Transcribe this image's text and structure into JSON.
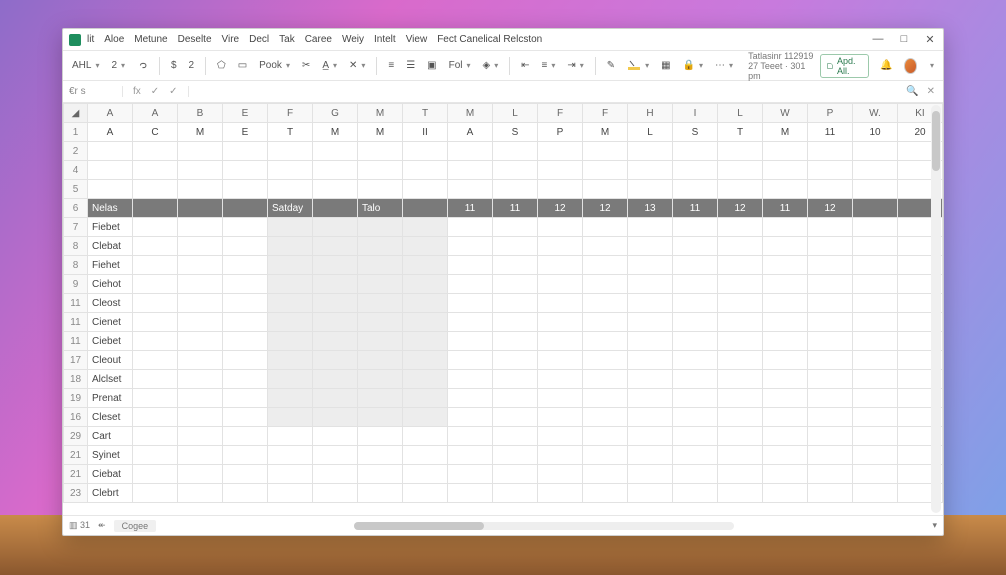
{
  "menu": [
    "lit",
    "Aloe",
    "Metune",
    "Deselte",
    "Vire",
    "Decl",
    "Tak",
    "Caree",
    "Weiy",
    "Intelt",
    "View",
    "Fect Canelical Relcston"
  ],
  "winctrls": {
    "min": "—",
    "max": "□",
    "close": "✕"
  },
  "toolbar": {
    "a": "AHL",
    "fmt": "Pook",
    "fol": "Fol",
    "info_line1": "Tatlasinr 112919",
    "info_line2": "27 Teeet · 301 pm",
    "pill": "Apd. All."
  },
  "formulabar": {
    "namebox": "€r s",
    "fx": "fx",
    "check": "✓",
    "check2": "✓",
    "search": "🔍",
    "close": "✕"
  },
  "col_headers_top": [
    "A",
    "A",
    "B",
    "E",
    "F",
    "G",
    "M",
    "T",
    "M",
    "L",
    "F",
    "F",
    "H",
    "I",
    "L",
    "W",
    "P",
    "W.",
    "KI"
  ],
  "col_headers_row1": [
    "A",
    "C",
    "M",
    "E",
    "T",
    "M",
    "M",
    "II",
    "A",
    "S",
    "P",
    "M",
    "L",
    "S",
    "T",
    "M",
    "11",
    "10",
    "20"
  ],
  "rows": [
    {
      "n": "2",
      "cells": [
        "",
        "",
        "",
        "",
        "",
        "",
        "",
        "",
        "",
        "",
        "",
        "",
        "",
        "",
        "",
        "",
        "",
        "",
        ""
      ]
    },
    {
      "n": "4",
      "cells": [
        "",
        "",
        "",
        "",
        "",
        "",
        "",
        "",
        "",
        "",
        "",
        "",
        "",
        "",
        "",
        "",
        "",
        "",
        ""
      ]
    },
    {
      "n": "5",
      "cells": [
        "",
        "",
        "",
        "",
        "",
        "",
        "",
        "",
        "",
        "",
        "",
        "",
        "",
        "",
        "",
        "",
        "",
        "",
        ""
      ]
    },
    {
      "n": "6",
      "dark": true,
      "cells": [
        "Nelas",
        "",
        "",
        "",
        "Satday",
        "",
        "Talo",
        "",
        "11",
        "11",
        "12",
        "12",
        "13",
        "11",
        "12",
        "11",
        "12",
        "",
        ""
      ]
    },
    {
      "n": "7",
      "sel": true,
      "cells": [
        "Fiebet",
        "",
        "",
        "",
        "",
        "",
        "",
        "",
        "",
        "",
        "",
        "",
        "",
        "",
        "",
        "",
        "",
        "",
        ""
      ]
    },
    {
      "n": "8",
      "sel": true,
      "cells": [
        "Clebat",
        "",
        "",
        "",
        "",
        "",
        "",
        "",
        "",
        "",
        "",
        "",
        "",
        "",
        "",
        "",
        "",
        "",
        ""
      ]
    },
    {
      "n": "8",
      "sel": true,
      "cells": [
        "Fiehet",
        "",
        "",
        "",
        "",
        "",
        "",
        "",
        "",
        "",
        "",
        "",
        "",
        "",
        "",
        "",
        "",
        "",
        ""
      ]
    },
    {
      "n": "9",
      "sel": true,
      "cells": [
        "Ciehot",
        "",
        "",
        "",
        "",
        "",
        "",
        "",
        "",
        "",
        "",
        "",
        "",
        "",
        "",
        "",
        "",
        "",
        ""
      ]
    },
    {
      "n": "11",
      "sel": true,
      "cells": [
        "Cleost",
        "",
        "",
        "",
        "",
        "",
        "",
        "",
        "",
        "",
        "",
        "",
        "",
        "",
        "",
        "",
        "",
        "",
        ""
      ]
    },
    {
      "n": "11",
      "sel": true,
      "cells": [
        "Cienet",
        "",
        "",
        "",
        "",
        "",
        "",
        "",
        "",
        "",
        "",
        "",
        "",
        "",
        "",
        "",
        "",
        "",
        ""
      ]
    },
    {
      "n": "11",
      "sel": true,
      "cells": [
        "Ciebet",
        "",
        "",
        "",
        "",
        "",
        "",
        "",
        "",
        "",
        "",
        "",
        "",
        "",
        "",
        "",
        "",
        "",
        ""
      ]
    },
    {
      "n": "17",
      "sel": true,
      "cells": [
        "Cleout",
        "",
        "",
        "",
        "",
        "",
        "",
        "",
        "",
        "",
        "",
        "",
        "",
        "",
        "",
        "",
        "",
        "",
        ""
      ]
    },
    {
      "n": "18",
      "sel": true,
      "cells": [
        "Alclset",
        "",
        "",
        "",
        "",
        "",
        "",
        "",
        "",
        "",
        "",
        "",
        "",
        "",
        "",
        "",
        "",
        "",
        ""
      ]
    },
    {
      "n": "19",
      "sel": true,
      "cells": [
        "Prenat",
        "",
        "",
        "",
        "",
        "",
        "",
        "",
        "",
        "",
        "",
        "",
        "",
        "",
        "",
        "",
        "",
        "",
        ""
      ]
    },
    {
      "n": "16",
      "sel": true,
      "cells": [
        "Cleset",
        "",
        "",
        "",
        "",
        "",
        "",
        "",
        "",
        "",
        "",
        "",
        "",
        "",
        "",
        "",
        "",
        "",
        ""
      ]
    },
    {
      "n": "29",
      "cells": [
        "Cart",
        "",
        "",
        "",
        "",
        "",
        "",
        "",
        "",
        "",
        "",
        "",
        "",
        "",
        "",
        "",
        "",
        "",
        ""
      ]
    },
    {
      "n": "21",
      "cells": [
        "Syinet",
        "",
        "",
        "",
        "",
        "",
        "",
        "",
        "",
        "",
        "",
        "",
        "",
        "",
        "",
        "",
        "",
        "",
        ""
      ]
    },
    {
      "n": "21",
      "cells": [
        "Ciebat",
        "",
        "",
        "",
        "",
        "",
        "",
        "",
        "",
        "",
        "",
        "",
        "",
        "",
        "",
        "",
        "",
        "",
        ""
      ]
    },
    {
      "n": "23",
      "cells": [
        "Clebrt",
        "",
        "",
        "",
        "",
        "",
        "",
        "",
        "",
        "",
        "",
        "",
        "",
        "",
        "",
        "",
        "",
        "",
        ""
      ]
    }
  ],
  "statusbar": {
    "a": "31",
    "b": "↞",
    "tab": "Cogee"
  }
}
